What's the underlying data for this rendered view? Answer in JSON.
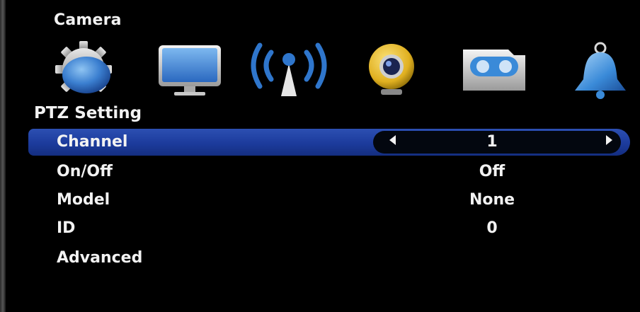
{
  "menu": {
    "title": "Camera"
  },
  "icons": [
    {
      "name": "gear-icon",
      "color": "#3b7fd0"
    },
    {
      "name": "monitor-icon",
      "color": "#3a86d6"
    },
    {
      "name": "wireless-antenna-icon",
      "color": "#2f76cc"
    },
    {
      "name": "webcam-icon",
      "color": "#e0b020"
    },
    {
      "name": "recorder-icon",
      "color": "#d8d8d8"
    },
    {
      "name": "bell-icon",
      "color": "#3a8ad8"
    }
  ],
  "section": {
    "title": "PTZ Setting"
  },
  "settings": [
    {
      "label": "Channel",
      "value": "1",
      "selected": true
    },
    {
      "label": "On/Off",
      "value": "Off",
      "selected": false
    },
    {
      "label": "Model",
      "value": "None",
      "selected": false
    },
    {
      "label": "ID",
      "value": "0",
      "selected": false
    },
    {
      "label": "Advanced",
      "value": "",
      "selected": false
    }
  ],
  "colors": {
    "selection": "#1c3b9c",
    "background": "#000000",
    "text": "#f2f2f2"
  }
}
